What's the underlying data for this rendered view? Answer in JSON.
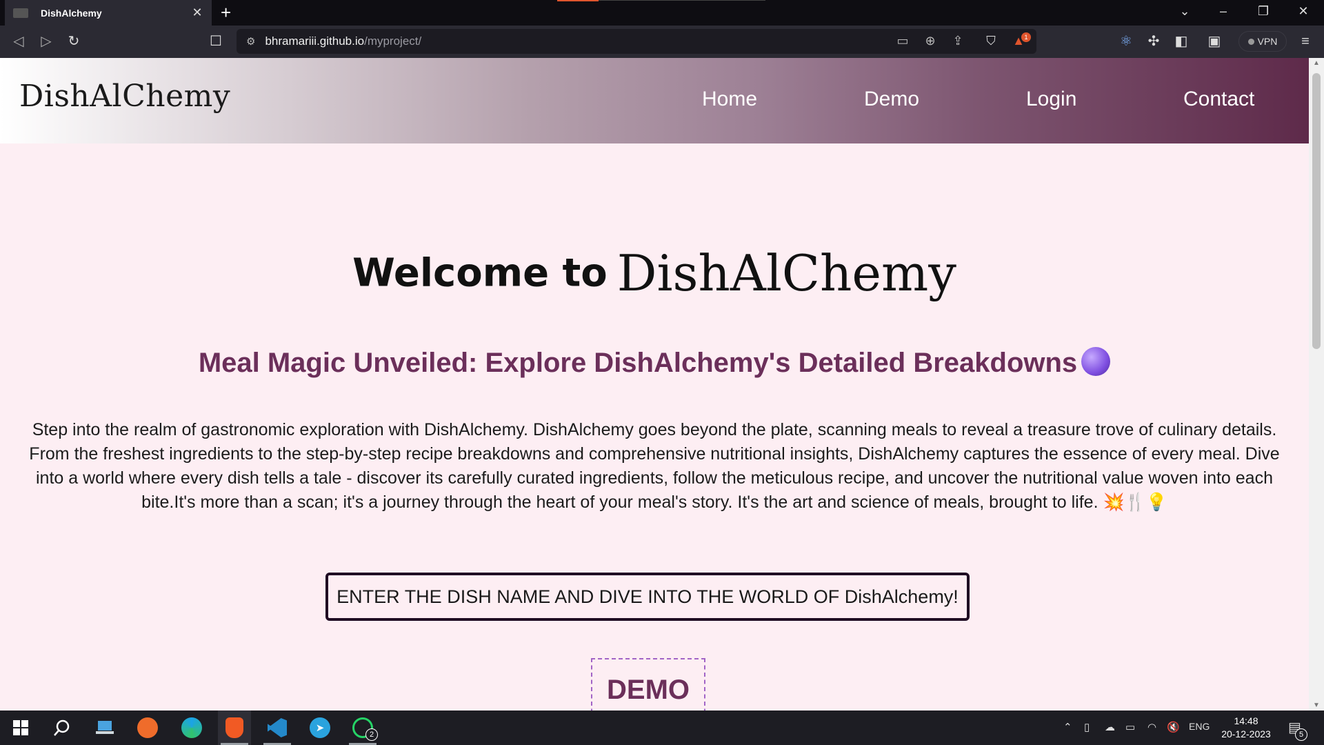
{
  "browser": {
    "tab_title": "DishAlchemy",
    "url_host": "bhramariii.github.io",
    "url_path": "/myproject/",
    "vpn_label": "VPN",
    "notification_count": "1"
  },
  "site": {
    "logo": "DishAlChemy",
    "nav": [
      "Home",
      "Demo",
      "Login",
      "Contact"
    ]
  },
  "hero": {
    "welcome": "Welcome to",
    "brand": "DishAlChemy",
    "subheading": "Meal Magic Unveiled: Explore DishAlchemy's Detailed Breakdowns",
    "intro": "Step into the realm of gastronomic exploration with DishAlchemy. DishAlchemy goes beyond the plate, scanning meals to reveal a treasure trove of culinary details. From the freshest ingredients to the step-by-step recipe breakdowns and comprehensive nutritional insights, DishAlchemy captures the essence of every meal. Dive into a world where every dish tells a tale - discover its carefully curated ingredients, follow the meticulous recipe, and uncover the nutritional value woven into each bite.It's more than a scan; it's a journey through the heart of your meal's story. It's the art and science of meals, brought to life. 💥🍴💡",
    "cta": "ENTER THE DISH NAME AND DIVE INTO THE WORLD OF DishAlchemy!",
    "demo_label": "DEMO"
  },
  "taskbar": {
    "language": "ENG",
    "time": "14:48",
    "date": "20-12-2023",
    "whatsapp_badge": "2",
    "notifications_badge": "5"
  },
  "colors": {
    "page_bg": "#fdeef3",
    "accent_purple": "#6b2f5a",
    "header_gradient_end": "#5e2a4a"
  }
}
